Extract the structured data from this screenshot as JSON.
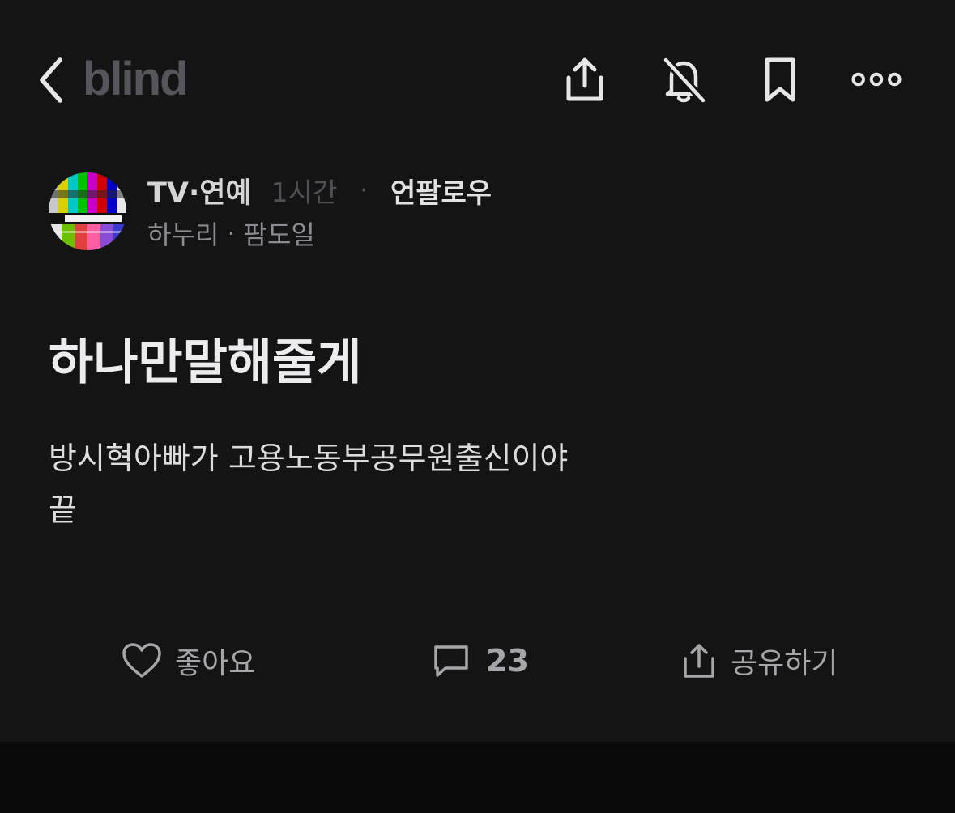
{
  "header": {
    "logo_text": "blind",
    "icons": [
      "back-chevron-icon",
      "share-icon",
      "bell-off-icon",
      "bookmark-icon",
      "more-icon"
    ]
  },
  "post": {
    "category": "TV·연예",
    "time_ago": "1시간",
    "separator": "·",
    "follow_label": "언팔로우",
    "author_company": "하누리",
    "author_separator": "·",
    "author_nickname": "팜도일",
    "title": "하나만말해줄게",
    "body_lines": [
      "방시혁아빠가 고용노동부공무원출신이야",
      "끝"
    ]
  },
  "actions": {
    "like_label": "좋아요",
    "comment_count": "23",
    "share_label": "공유하기"
  },
  "colors": {
    "background": "#141414",
    "logo": "#55565b",
    "icon": "#e6e6e8",
    "muted_text": "#8b8c91"
  }
}
